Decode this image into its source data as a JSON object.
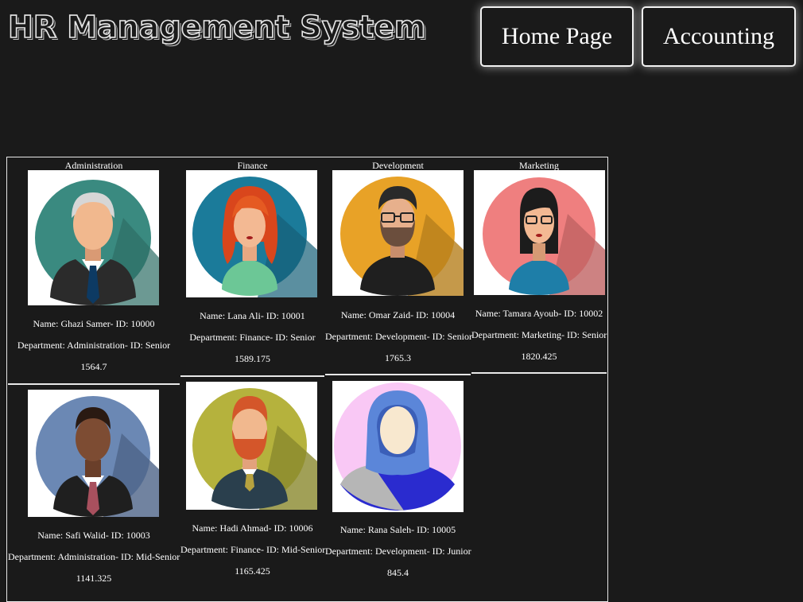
{
  "app_title": "HR Management System",
  "nav": {
    "home": "Home Page",
    "accounting": "Accounting"
  },
  "departments": [
    "Administration",
    "Finance",
    "Development",
    "Marketing"
  ],
  "employees": [
    {
      "name": "Name: Ghazi Samer- ID: 10000",
      "dept": "Department: Administration- ID: Senior",
      "salary": "1564.7",
      "avatar": "old-man-suit-avatar-icon",
      "bg": "#3a8a80"
    },
    {
      "name": "Name: Lana Ali- ID: 10001",
      "dept": "Department: Finance- ID: Senior",
      "salary": "1589.175",
      "avatar": "red-hair-woman-avatar-icon",
      "bg": "#1b7b9a"
    },
    {
      "name": "Name: Omar Zaid- ID: 10004",
      "dept": "Department: Development- ID: Senior",
      "salary": "1765.3",
      "avatar": "bearded-man-glasses-avatar-icon",
      "bg": "#e8a227"
    },
    {
      "name": "Name: Tamara Ayoub- ID: 10002",
      "dept": "Department: Marketing- ID: Senior",
      "salary": "1820.425",
      "avatar": "woman-glasses-avatar-icon",
      "bg": "#ef7f7f"
    },
    {
      "name": "Name: Safi Walid- ID: 10003",
      "dept": "Department: Administration- ID: Mid-Senior",
      "salary": "1141.325",
      "avatar": "man-suit-avatar-icon",
      "bg": "#6b88b4"
    },
    {
      "name": "Name: Hadi Ahmad- ID: 10006",
      "dept": "Department: Finance- ID: Mid-Senior",
      "salary": "1165.425",
      "avatar": "red-beard-man-avatar-icon",
      "bg": "#b5b23d"
    },
    {
      "name": "Name: Rana Saleh- ID: 10005",
      "dept": "Department: Development- ID: Junior",
      "salary": "845.4",
      "avatar": "hijab-woman-avatar-icon",
      "bg": "#f9c8f5"
    }
  ]
}
